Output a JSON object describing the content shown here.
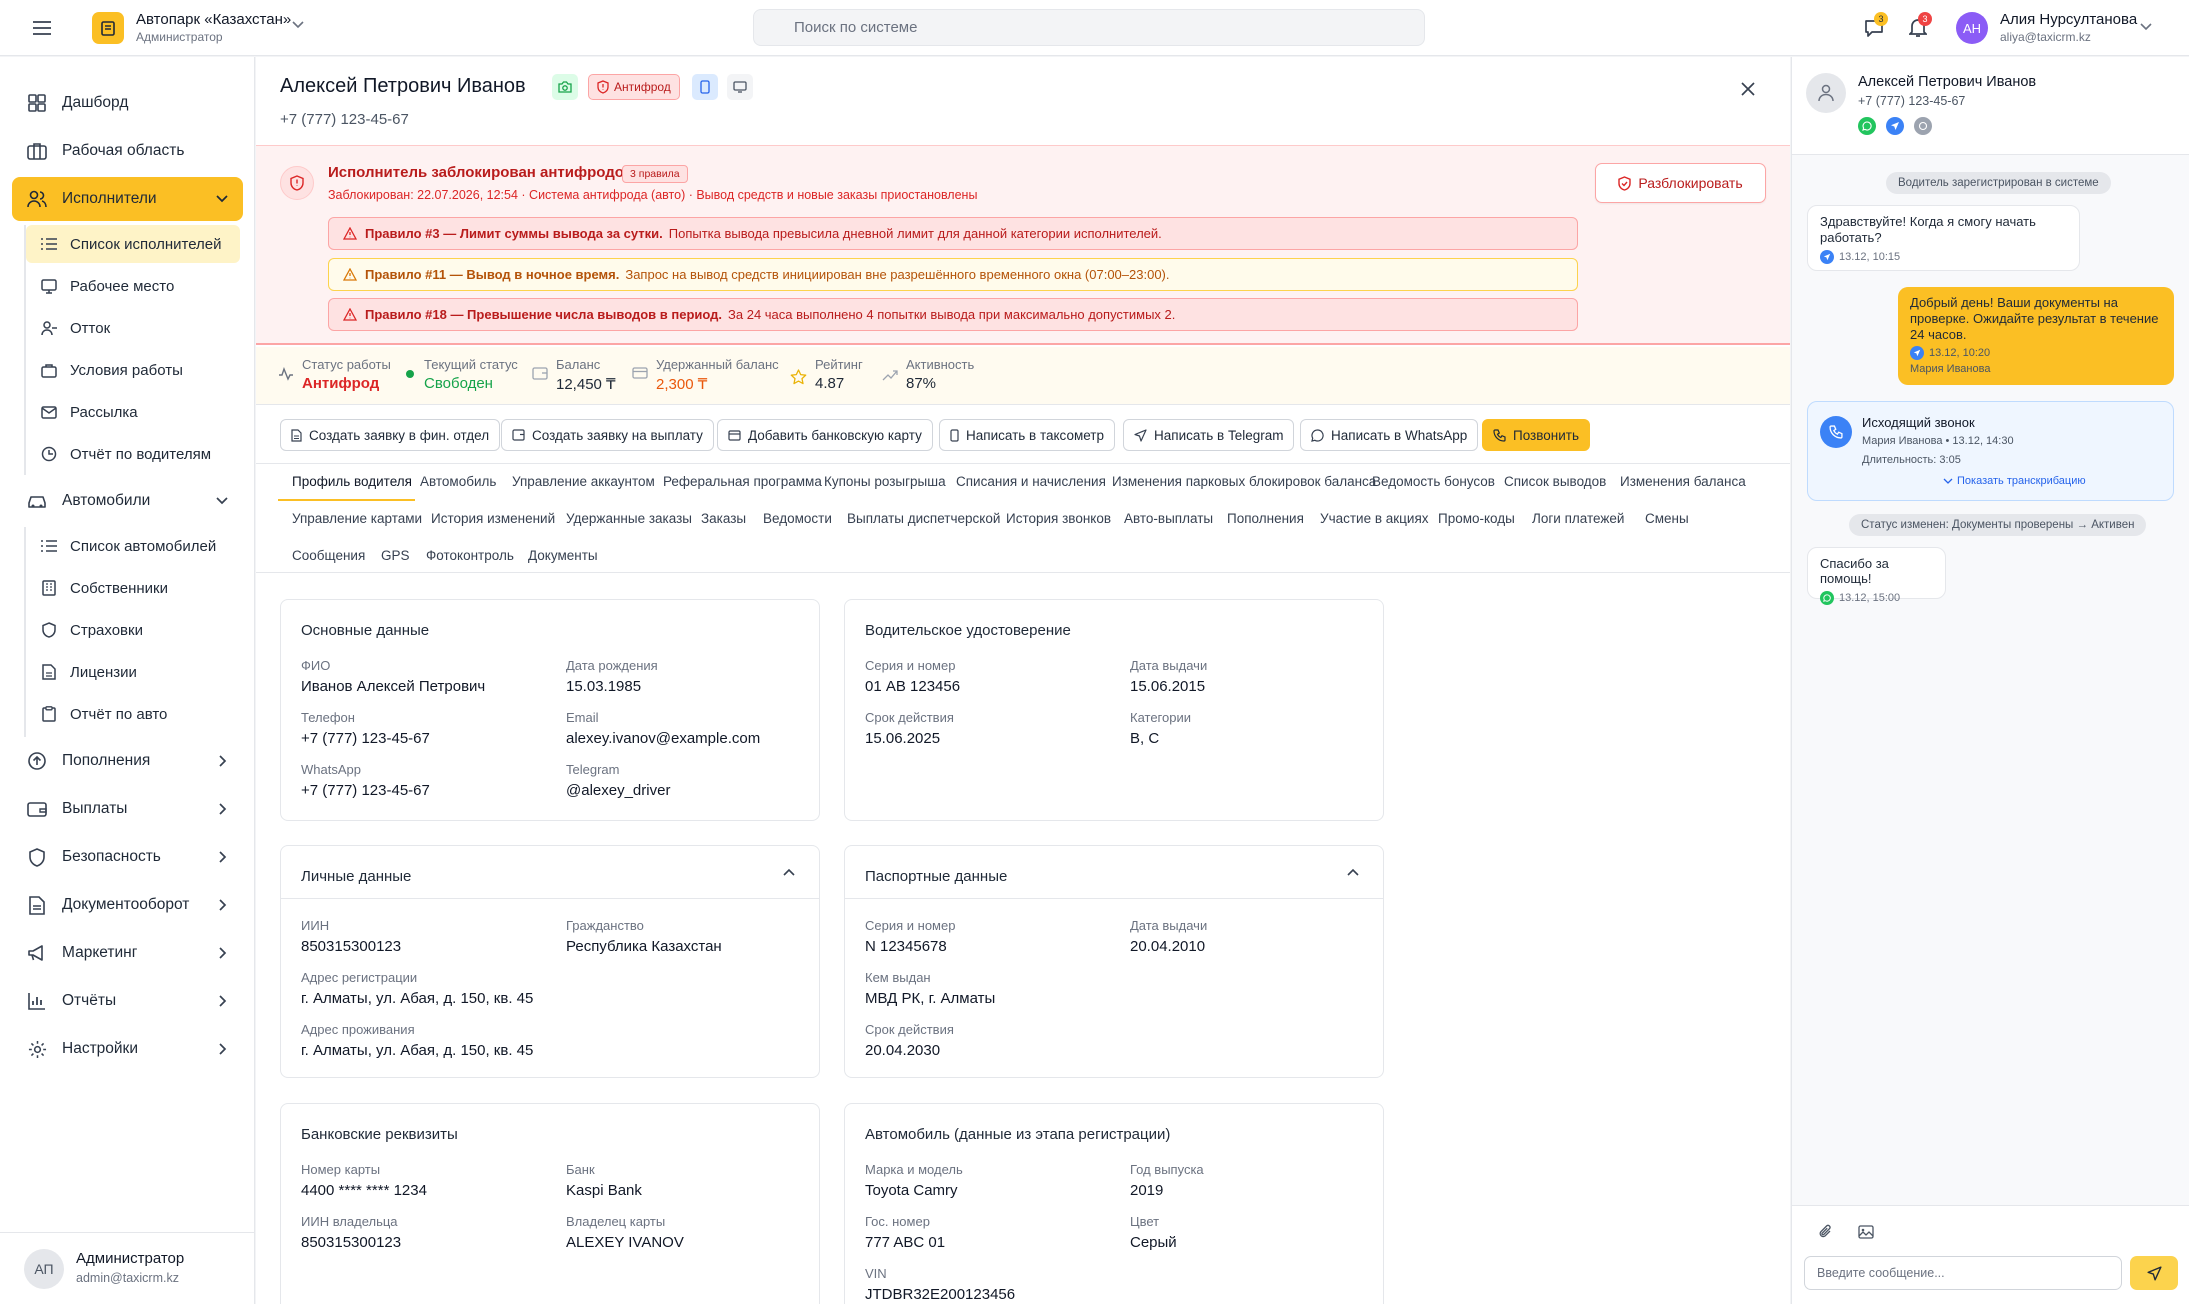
{
  "header": {
    "company": "Автопарк «Казахстан»",
    "role": "Администратор",
    "search_placeholder": "Поиск по системе",
    "chat_count": "3",
    "notif_count": "3",
    "user_initials": "АН",
    "user_name": "Алия Нурсултанова",
    "user_email": "aliya@taxicrm.kz"
  },
  "sidebar": {
    "dashboard": "Дашборд",
    "workspace": "Рабочая область",
    "performers": "Исполнители",
    "performers_sub": [
      "Список исполнителей",
      "Рабочее место",
      "Отток",
      "Условия работы",
      "Рассылка",
      "Отчёт по водителям"
    ],
    "cars": "Автомобили",
    "cars_sub": [
      "Список автомобилей",
      "Собственники",
      "Страховки",
      "Лицензии",
      "Отчёт по авто"
    ],
    "topups": "Пополнения",
    "payouts": "Выплаты",
    "security": "Безопасность",
    "docs": "Документооборот",
    "marketing": "Маркетинг",
    "reports": "Отчёты",
    "settings": "Настройки",
    "admin_initials": "АП",
    "admin_name": "Администратор",
    "admin_email": "admin@taxicrm.kz"
  },
  "driver": {
    "name": "Алексей Петрович Иванов",
    "phone": "+7 (777) 123-45-67",
    "antifraud_badge": "Антифрод"
  },
  "alert": {
    "title": "Исполнитель заблокирован антифродом",
    "rules_count": "3 правила",
    "subtitle": "Заблокирован: 22.07.2026, 12:54 · Система антифрода (авто) · Вывод средств и новые заказы приостановлены",
    "unblock_label": "Разблокировать",
    "rules": [
      {
        "title": "Правило #3 — Лимит суммы вывода за сутки.",
        "text": "Попытка вывода превысила дневной лимит для данной категории исполнителей."
      },
      {
        "title": "Правило #11 — Вывод в ночное время.",
        "text": "Запрос на вывод средств инициирован вне разрешённого временного окна (07:00–23:00)."
      },
      {
        "title": "Правило #18 — Превышение числа выводов в период.",
        "text": "За 24 часа выполнено 4 попытки вывода при максимально допустимых 2."
      }
    ]
  },
  "stats": [
    {
      "label": "Статус работы",
      "value": "Антифрод"
    },
    {
      "label": "Текущий статус",
      "value": "Свободен"
    },
    {
      "label": "Баланс",
      "value": "12,450 ₸"
    },
    {
      "label": "Удержанный баланс",
      "value": "2,300 ₸"
    },
    {
      "label": "Рейтинг",
      "value": "4.87"
    },
    {
      "label": "Активность",
      "value": "87%"
    }
  ],
  "actions": [
    "Создать заявку в фин. отдел",
    "Создать заявку на выплату",
    "Добавить банковскую карту",
    "Написать в таксометр",
    "Написать в Telegram",
    "Написать в WhatsApp",
    "Позвонить"
  ],
  "tabs": {
    "row1": [
      "Профиль водителя",
      "Автомобиль",
      "Управление аккаунтом",
      "Реферальная программа",
      "Купоны розыгрыша",
      "Списания и начисления",
      "Изменения парковых блокировок баланса",
      "Ведомость бонусов",
      "Список выводов",
      "Изменения баланса"
    ],
    "row2": [
      "Управление картами",
      "История изменений",
      "Удержанные заказы",
      "Заказы",
      "Ведомости",
      "Выплаты диспетчерской",
      "История звонков",
      "Авто-выплаты",
      "Пополнения",
      "Участие в акциях",
      "Промо-коды",
      "Логи платежей",
      "Смены"
    ],
    "row3": [
      "Сообщения",
      "GPS",
      "Фотоконтроль",
      "Документы"
    ]
  },
  "cards": {
    "basic": {
      "title": "Основные данные",
      "fio_label": "ФИО",
      "fio": "Иванов Алексей Петрович",
      "dob_label": "Дата рождения",
      "dob": "15.03.1985",
      "phone_label": "Телефон",
      "phone": "+7 (777) 123-45-67",
      "email_label": "Email",
      "email": "alexey.ivanov@example.com",
      "wa_label": "WhatsApp",
      "wa": "+7 (777) 123-45-67",
      "tg_label": "Telegram",
      "tg": "@alexey_driver"
    },
    "license": {
      "title": "Водительское удостоверение",
      "num_label": "Серия и номер",
      "num": "01 АВ 123456",
      "issued_label": "Дата выдачи",
      "issued": "15.06.2015",
      "valid_label": "Срок действия",
      "valid": "15.06.2025",
      "cat_label": "Категории",
      "cat": "B, C"
    },
    "personal": {
      "title": "Личные данные",
      "iin_label": "ИИН",
      "iin": "850315300123",
      "citizen_label": "Гражданство",
      "citizen": "Республика Казахстан",
      "reg_label": "Адрес регистрации",
      "reg": "г. Алматы, ул. Абая, д. 150, кв. 45",
      "live_label": "Адрес проживания",
      "live": "г. Алматы, ул. Абая, д. 150, кв. 45"
    },
    "passport": {
      "title": "Паспортные данные",
      "num_label": "Серия и номер",
      "num": "N 12345678",
      "issued_label": "Дата выдачи",
      "issued": "20.04.2010",
      "by_label": "Кем выдан",
      "by": "МВД РК, г. Алматы",
      "valid_label": "Срок действия",
      "valid": "20.04.2030"
    },
    "bank": {
      "title": "Банковские реквизиты",
      "card_label": "Номер карты",
      "card": "4400 **** **** 1234",
      "bank_label": "Банк",
      "bank": "Kaspi Bank",
      "iin_label": "ИИН владельца",
      "iin": "850315300123",
      "owner_label": "Владелец карты",
      "owner": "ALEXEY IVANOV"
    },
    "car": {
      "title": "Автомобиль (данные из этапа регистрации)",
      "model_label": "Марка и модель",
      "model": "Toyota Camry",
      "year_label": "Год выпуска",
      "year": "2019",
      "plate_label": "Гос. номер",
      "plate": "777 ABC 01",
      "color_label": "Цвет",
      "color": "Серый",
      "vin_label": "VIN",
      "vin": "JTDBR32E200123456"
    }
  },
  "chat": {
    "name": "Алексей Петрович Иванов",
    "phone": "+7 (777) 123-45-67",
    "sys1": "Водитель зарегистрирован в системе",
    "m1_text": "Здравствуйте! Когда я смогу начать работать?",
    "m1_time": "13.12, 10:15",
    "m2_text": "Добрый день! Ваши документы на проверке. Ожидайте результат в течение 24 часов.",
    "m2_time": "13.12, 10:20",
    "m2_author": "Мария Иванова",
    "call_title": "Исходящий звонок",
    "call_meta": "Мария Иванова • 13.12, 14:30",
    "call_duration": "Длительность: 3:05",
    "call_transcript": "Показать транскрибацию",
    "sys2": "Статус изменен: Документы проверены → Активен",
    "m3_text": "Спасибо за помощь!",
    "m3_time": "13.12, 15:00",
    "input_placeholder": "Введите сообщение..."
  },
  "colors": {
    "accent": "#fbbf24",
    "danger": "#dc2626",
    "success": "#16a34a",
    "orange": "#ea580c"
  }
}
